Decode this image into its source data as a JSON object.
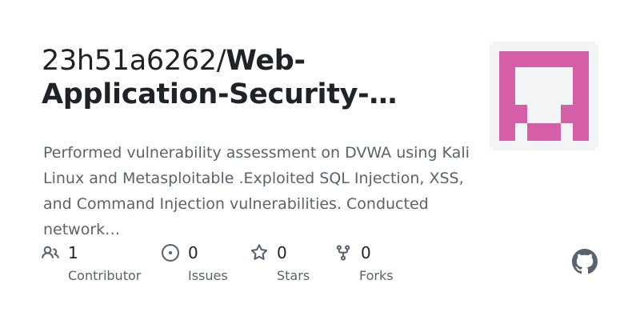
{
  "repo": {
    "owner": "23h51a6262",
    "separator": "/",
    "name_line1": "Web-",
    "name_line2": "Application-Security-…",
    "description": "Performed vulnerability assessment on DVWA using Kali Linux and Metasploitable .Exploited SQL Injection, XSS, and Command Injection vulnerabilities. Conducted network…"
  },
  "avatar": {
    "icon": "identicon",
    "color": "#d55fa6",
    "background": "#f3f4f6"
  },
  "stats": {
    "contributors": {
      "count": "1",
      "label": "Contributor",
      "icon": "people-icon"
    },
    "issues": {
      "count": "0",
      "label": "Issues",
      "icon": "issue-opened-icon"
    },
    "stars": {
      "count": "0",
      "label": "Stars",
      "icon": "star-icon"
    },
    "forks": {
      "count": "0",
      "label": "Forks",
      "icon": "repo-forked-icon"
    }
  },
  "branding": {
    "icon": "github-mark-icon",
    "color": "#59636e"
  },
  "colors": {
    "text_primary": "#1f2328",
    "text_secondary": "#59636e"
  }
}
